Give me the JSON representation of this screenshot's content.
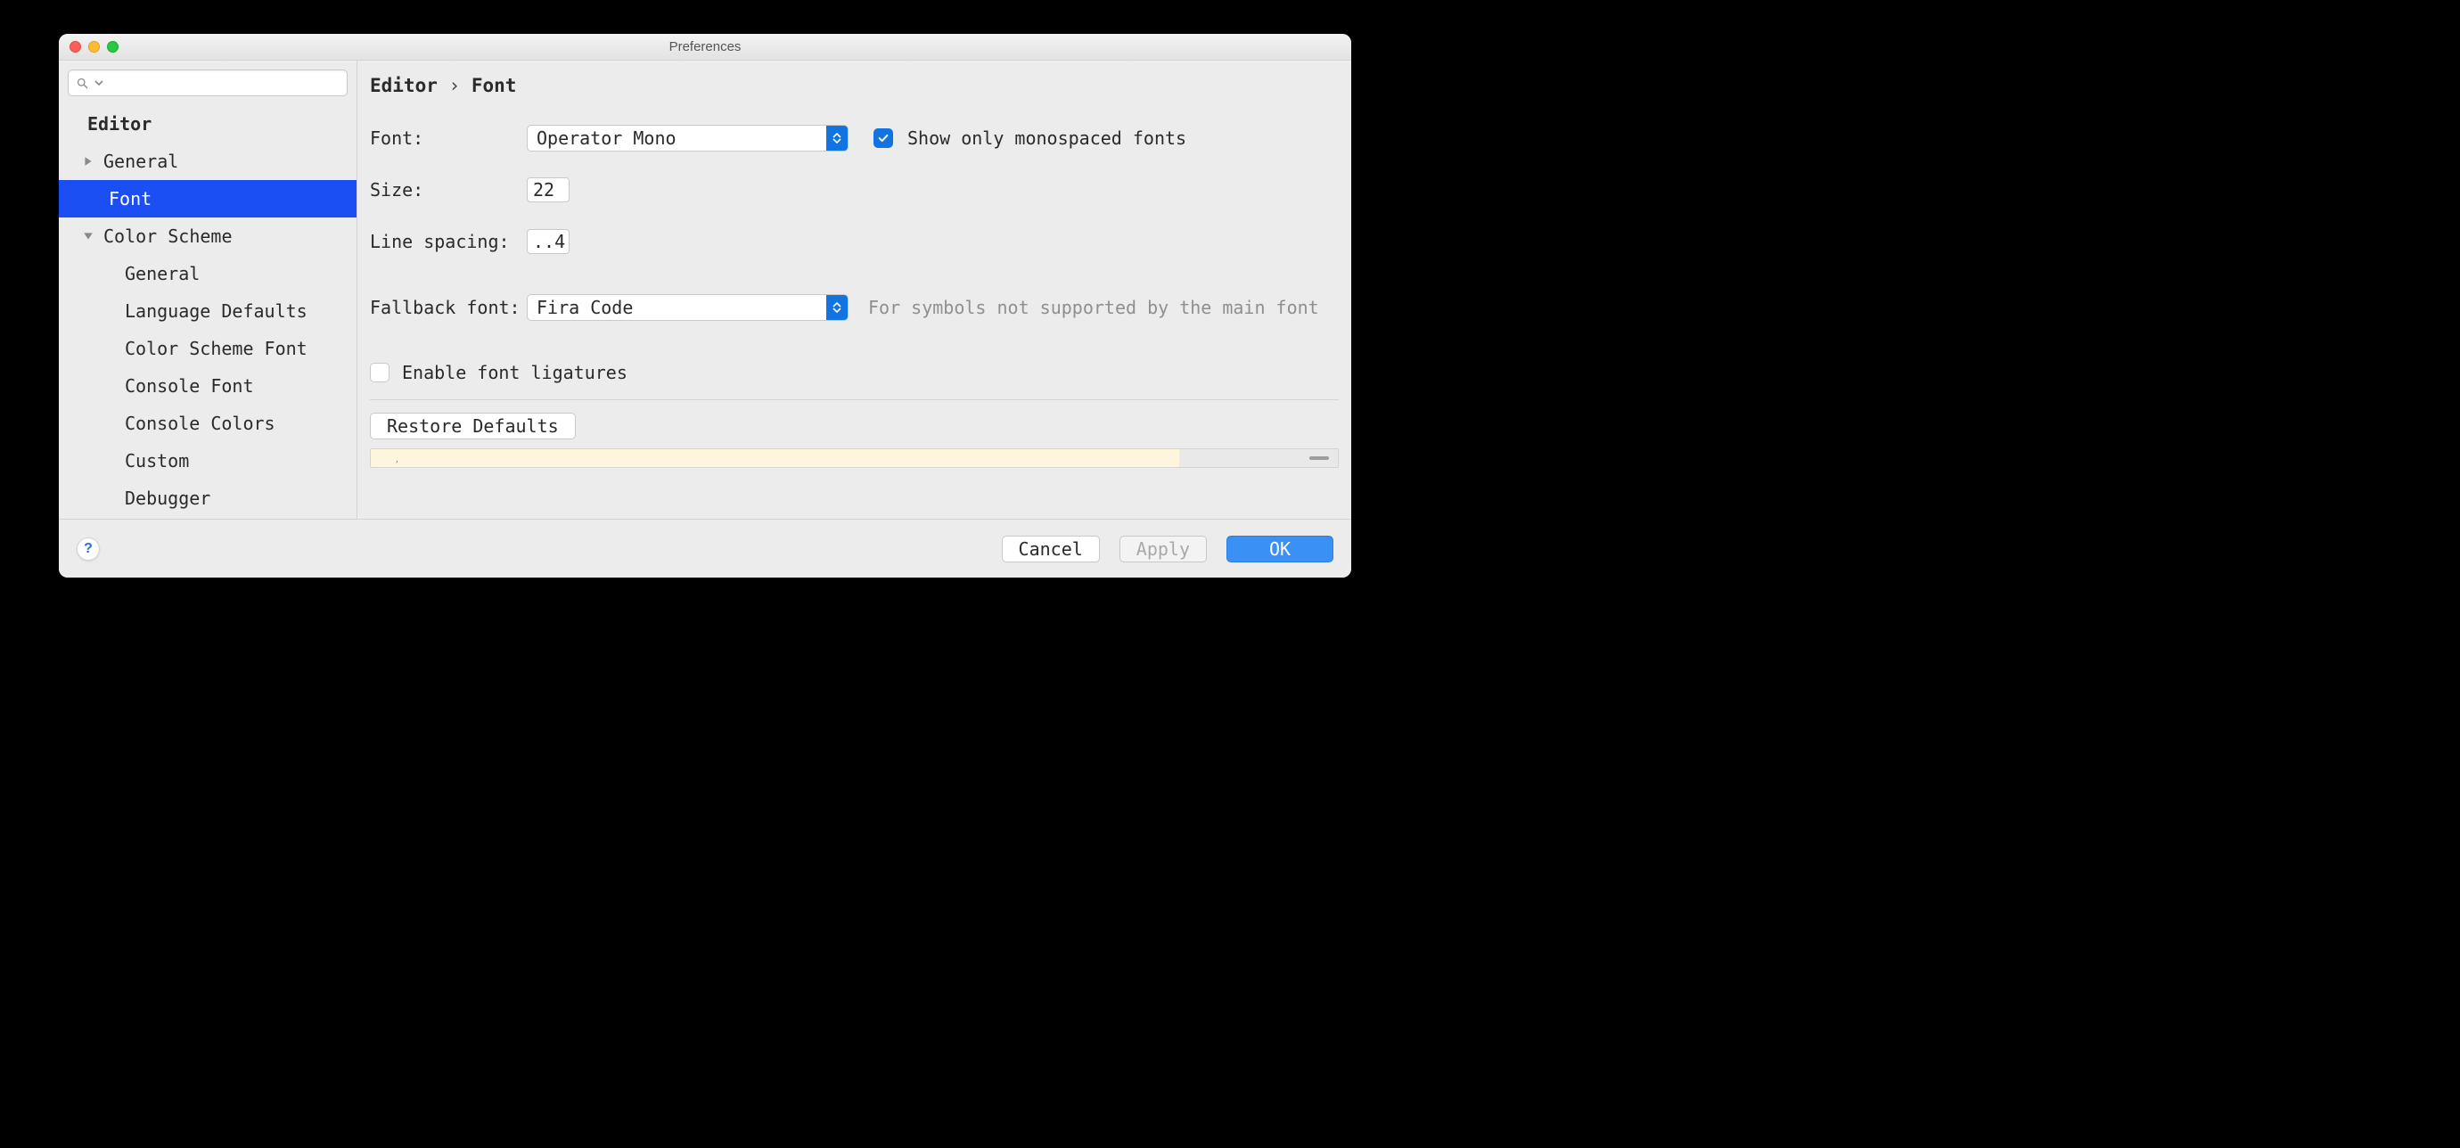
{
  "window": {
    "title": "Preferences"
  },
  "search": {
    "placeholder": ""
  },
  "sidebar": {
    "section": "Editor",
    "items": [
      {
        "label": "General",
        "expanded": false,
        "level": 2
      },
      {
        "label": "Font",
        "selected": true,
        "level": 2
      },
      {
        "label": "Color Scheme",
        "expanded": true,
        "level": 2
      },
      {
        "label": "General",
        "level": 3
      },
      {
        "label": "Language Defaults",
        "level": 3
      },
      {
        "label": "Color Scheme Font",
        "level": 3
      },
      {
        "label": "Console Font",
        "level": 3
      },
      {
        "label": "Console Colors",
        "level": 3
      },
      {
        "label": "Custom",
        "level": 3
      },
      {
        "label": "Debugger",
        "level": 3
      }
    ]
  },
  "breadcrumb": {
    "a": "Editor",
    "sep": "›",
    "b": "Font"
  },
  "form": {
    "font_label": "Font:",
    "font_value": "Operator Mono",
    "show_monospaced_label": "Show only monospaced fonts",
    "show_monospaced_checked": true,
    "size_label": "Size:",
    "size_value": "22",
    "line_spacing_label": "Line spacing:",
    "line_spacing_value": "..4",
    "fallback_label": "Fallback font:",
    "fallback_value": "Fira Code",
    "fallback_hint": "For symbols not supported by the main font",
    "ligatures_label": "Enable font ligatures",
    "ligatures_checked": false,
    "restore_label": "Restore Defaults",
    "preview_placeholder": ","
  },
  "footer": {
    "help": "?",
    "cancel": "Cancel",
    "apply": "Apply",
    "ok": "OK"
  }
}
